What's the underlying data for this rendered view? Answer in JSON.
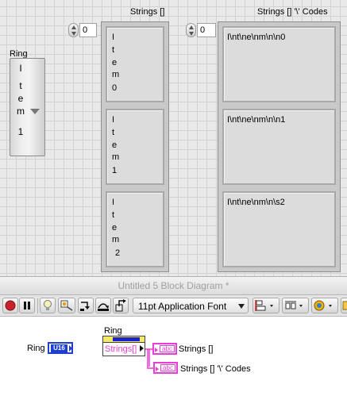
{
  "front_panel": {
    "ring": {
      "label": "Ring",
      "display_chars": [
        "I",
        "t",
        "e",
        "m",
        "1"
      ]
    },
    "strings_array": {
      "label": "Strings []",
      "index": "0",
      "items": [
        {
          "chars": [
            "I",
            "t",
            "e",
            "m",
            "0"
          ]
        },
        {
          "chars": [
            "I",
            "t",
            "e",
            "m",
            "1"
          ]
        },
        {
          "chars": [
            "I",
            "t",
            "e",
            "m",
            "2"
          ]
        }
      ]
    },
    "codes_array": {
      "label": "Strings [] '\\' Codes",
      "index": "0",
      "items": [
        "I\\nt\\ne\\nm\\n\\n0",
        "I\\nt\\ne\\nm\\n\\n1",
        "I\\nt\\ne\\nm\\n\\s2"
      ]
    }
  },
  "block_diagram": {
    "title": "Untitled 5 Block Diagram *",
    "font_selector": "11pt Application Font",
    "nodes": {
      "ring_terminal_label": "Ring",
      "ring_terminal_type": "U16",
      "property_node_owner": "Ring",
      "property_node_property": "Strings[]",
      "indicator1_label": "Strings []",
      "indicator2_label": "Strings [] '\\' Codes",
      "indicator_type": "abc"
    }
  },
  "colors": {
    "string_wire": "#ea3cd8",
    "u16_terminal": "#1f3fd0",
    "property_node_header": "#1a23c8"
  }
}
